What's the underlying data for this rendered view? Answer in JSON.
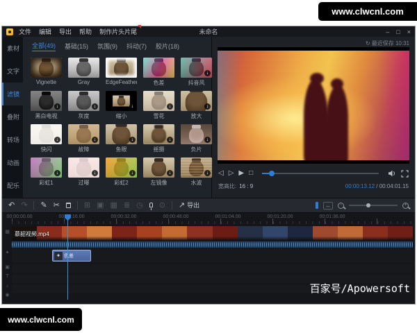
{
  "watermark": {
    "text": "www.clwcnl.com"
  },
  "credit": {
    "text": "百家号/Apowersoft"
  },
  "colors": {
    "accent": "#2e7fd4",
    "filter_clip": "#48639e",
    "waveform": "#1d3a5c",
    "panel_bg": "#1f232a"
  },
  "titlebar": {
    "title": "未命名",
    "menus": [
      {
        "label": "文件",
        "badge": false
      },
      {
        "label": "编辑",
        "badge": false
      },
      {
        "label": "导出",
        "badge": false
      },
      {
        "label": "帮助",
        "badge": false
      },
      {
        "label": "制作片头片尾",
        "badge": true
      }
    ],
    "window_controls": [
      {
        "name": "minimize-button",
        "glyph": "–"
      },
      {
        "name": "maximize-button",
        "glyph": "□"
      },
      {
        "name": "close-button",
        "glyph": "×"
      }
    ]
  },
  "sidebar": {
    "items": [
      {
        "label": "素材",
        "selected": false
      },
      {
        "label": "文字",
        "selected": false
      },
      {
        "label": "滤镜",
        "selected": true
      },
      {
        "label": "叠附",
        "selected": false
      },
      {
        "label": "转场",
        "selected": false
      },
      {
        "label": "动画",
        "selected": false
      },
      {
        "label": "配乐",
        "selected": false
      }
    ]
  },
  "filter_panel": {
    "tabs": [
      {
        "label": "全部(49)",
        "selected": true
      },
      {
        "label": "基础(15)",
        "selected": false
      },
      {
        "label": "氛围(9)",
        "selected": false
      },
      {
        "label": "抖动(7)",
        "selected": false
      },
      {
        "label": "胶片(18)",
        "selected": false
      }
    ],
    "filters": [
      {
        "name": "Vignette",
        "dl": false,
        "cls": "f-vignette"
      },
      {
        "name": "Gray",
        "dl": false,
        "cls": "f-gray"
      },
      {
        "name": "EdgeFeather",
        "dl": false,
        "cls": "f-edge"
      },
      {
        "name": "色差",
        "dl": false,
        "cls": "f-chroma"
      },
      {
        "name": "抖音风",
        "dl": true,
        "cls": "f-douyin"
      },
      {
        "name": "黑白电视",
        "dl": true,
        "cls": "f-bwtv"
      },
      {
        "name": "灰度",
        "dl": true,
        "cls": "f-gray2"
      },
      {
        "name": "缩小",
        "dl": true,
        "cls": "f-shrink"
      },
      {
        "name": "雪花",
        "dl": true,
        "cls": "f-snow"
      },
      {
        "name": "放大",
        "dl": true,
        "cls": "f-zoom"
      },
      {
        "name": "快闪",
        "dl": true,
        "cls": "f-flash"
      },
      {
        "name": "故障",
        "dl": true,
        "cls": "f-glitch"
      },
      {
        "name": "鱼眼",
        "dl": true,
        "cls": "f-fisheye"
      },
      {
        "name": "摇摄",
        "dl": true,
        "cls": "f-pan"
      },
      {
        "name": "负片",
        "dl": true,
        "cls": "f-negative"
      },
      {
        "name": "彩虹1",
        "dl": true,
        "cls": "f-rainbow1"
      },
      {
        "name": "过曝",
        "dl": true,
        "cls": "f-overexposed"
      },
      {
        "name": "彩虹2",
        "dl": true,
        "cls": "f-rainbow2"
      },
      {
        "name": "左镜像",
        "dl": true,
        "cls": "f-mirror"
      },
      {
        "name": "水波",
        "dl": true,
        "cls": "f-ripple"
      }
    ]
  },
  "preview": {
    "last_saved": "最近保存 10:31",
    "controls": [
      {
        "name": "prev-frame-button",
        "glyph": "◁"
      },
      {
        "name": "play-button",
        "glyph": "▷"
      },
      {
        "name": "next-frame-button",
        "glyph": "▶"
      },
      {
        "name": "stop-button",
        "glyph": "□"
      }
    ],
    "progress_pct": 8,
    "aspect_label": "宽高比:",
    "aspect_value": "16 : 9",
    "time_current": "00:00:13.12",
    "time_sep": " / ",
    "time_total": "00:04:01.15"
  },
  "toolbar": {
    "items": [
      {
        "name": "undo-icon",
        "glyph": "↶",
        "active": true
      },
      {
        "name": "redo-icon",
        "glyph": "↷",
        "active": false
      },
      {
        "sep": true
      },
      {
        "name": "edit-icon",
        "glyph": "✎",
        "active": true
      },
      {
        "name": "split-icon",
        "glyph": "✂",
        "active": true
      },
      {
        "name": "delete-icon",
        "css": "ic-trash",
        "active": true
      },
      {
        "sep": true
      },
      {
        "name": "crop-icon",
        "glyph": "⊞",
        "active": false
      },
      {
        "name": "pip-icon",
        "glyph": "▣",
        "active": false
      },
      {
        "name": "mosaic-icon",
        "glyph": "▦",
        "active": false
      },
      {
        "name": "subtitle-icon",
        "glyph": "≣",
        "active": false
      },
      {
        "name": "speed-icon",
        "glyph": "◷",
        "active": false
      },
      {
        "name": "record-icon",
        "css": "ic-mic",
        "active": true
      },
      {
        "name": "snapshot-icon",
        "glyph": "⊙",
        "active": false
      },
      {
        "sep": true
      },
      {
        "name": "export-icon",
        "glyph": "↗",
        "active": true,
        "label": "导出"
      }
    ],
    "zoom_pct": 40
  },
  "timeline": {
    "ruler_labels": [
      "00:00:00.00",
      "00:00:16.00",
      "00:00:32.00",
      "00:00:48.00",
      "00:01:04.00",
      "00:01:20.00",
      "00:01:36.00"
    ],
    "clip_name": "慕韶视频.mp4",
    "filter_clip_label": "色差",
    "wand_glyph": "✦",
    "rail_icons": [
      {
        "name": "video-track-icon",
        "glyph": "▦"
      },
      {
        "name": "effect-track-icon",
        "glyph": "✦"
      },
      {
        "name": "overlay-track-icon",
        "glyph": "▣"
      },
      {
        "name": "text-track-icon",
        "glyph": "T"
      },
      {
        "name": "music-track-icon",
        "glyph": "♪"
      },
      {
        "name": "voice-track-icon",
        "glyph": "◉"
      }
    ],
    "clip_colors": [
      "#17120e",
      "#8a2c1c",
      "#b54f2a",
      "#d07a3c",
      "#7c2418",
      "#a8411f",
      "#c46a33",
      "#8e3120",
      "#6b1d14",
      "#253046",
      "#32456b",
      "#1d2840",
      "#9e4a2e",
      "#c06a38",
      "#8a2e1d",
      "#701f15"
    ]
  }
}
